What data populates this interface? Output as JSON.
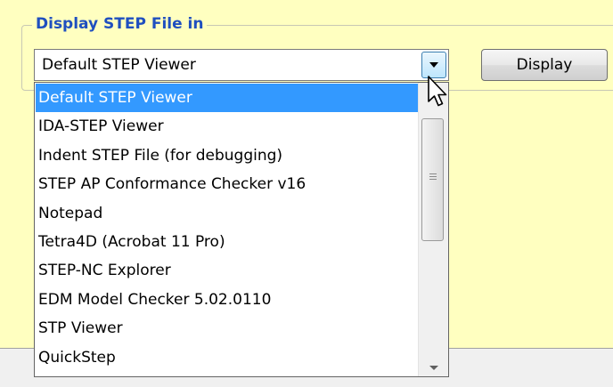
{
  "group": {
    "title": "Display STEP File in"
  },
  "combo": {
    "selected": "Default STEP Viewer"
  },
  "display_button": {
    "label": "Display"
  },
  "dropdown": {
    "options": [
      {
        "label": "Default STEP Viewer",
        "selected": true
      },
      {
        "label": "IDA-STEP Viewer"
      },
      {
        "label": "Indent STEP File (for debugging)"
      },
      {
        "label": "STEP AP Conformance Checker v16"
      },
      {
        "label": "Notepad"
      },
      {
        "label": "Tetra4D (Acrobat 11 Pro)"
      },
      {
        "label": "STEP-NC Explorer"
      },
      {
        "label": "EDM Model Checker 5.02.0110"
      },
      {
        "label": "STP Viewer"
      },
      {
        "label": "QuickStep"
      }
    ]
  },
  "colors": {
    "panel_background": "#ffffc0",
    "group_title": "#1f4fbf",
    "selection": "#3399ff"
  }
}
